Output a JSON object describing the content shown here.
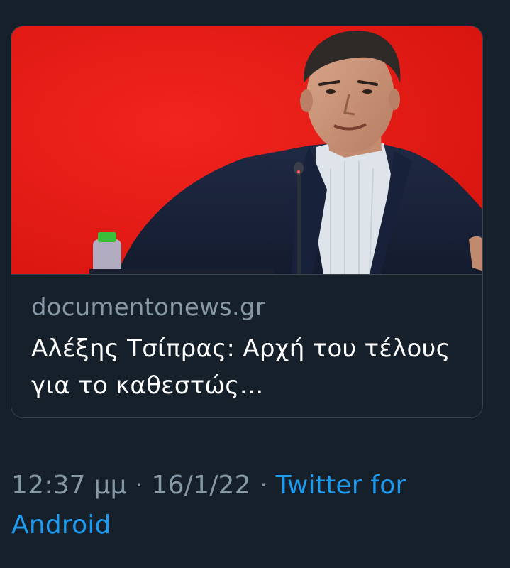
{
  "card": {
    "domain": "documentonews.gr",
    "title": "Αλέξης Τσίπρας: Αρχή του τέλους για το καθεστώς…",
    "image_accent": "#ea1c1c"
  },
  "meta": {
    "time": "12:37 μμ",
    "separator": " · ",
    "date": "16/1/22",
    "source": "Twitter for Android"
  },
  "colors": {
    "background": "#15202b",
    "muted_text": "#8899a6",
    "link": "#1d9bf0",
    "border": "#38444d"
  }
}
